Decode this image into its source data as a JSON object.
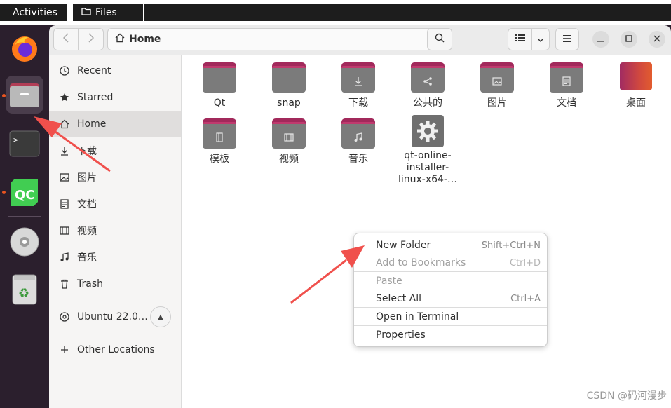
{
  "topbar": {
    "activities": "Activities",
    "app_name": "Files"
  },
  "dock": {
    "items": [
      "firefox-icon",
      "files-icon",
      "terminal-icon",
      "qt-creator-icon",
      "dvd-icon",
      "trash-icon"
    ]
  },
  "headerbar": {
    "location": "Home"
  },
  "sidebar": {
    "items": [
      {
        "label": "Recent",
        "icon": "clock-icon"
      },
      {
        "label": "Starred",
        "icon": "star-icon"
      },
      {
        "label": "Home",
        "icon": "home-icon"
      },
      {
        "label": "下载",
        "icon": "download-icon"
      },
      {
        "label": "图片",
        "icon": "image-icon"
      },
      {
        "label": "文档",
        "icon": "document-icon"
      },
      {
        "label": "视频",
        "icon": "video-icon"
      },
      {
        "label": "音乐",
        "icon": "music-icon"
      },
      {
        "label": "Trash",
        "icon": "trash-icon"
      }
    ],
    "drive": "Ubuntu 22.0…",
    "other": "Other Locations"
  },
  "files": [
    {
      "name": "Qt",
      "glyph": ""
    },
    {
      "name": "snap",
      "glyph": ""
    },
    {
      "name": "下载",
      "glyph": "download"
    },
    {
      "name": "公共的",
      "glyph": "share"
    },
    {
      "name": "图片",
      "glyph": "image"
    },
    {
      "name": "文档",
      "glyph": "document"
    },
    {
      "name": "桌面",
      "glyph": "desktop"
    },
    {
      "name": "模板",
      "glyph": "template"
    },
    {
      "name": "视频",
      "glyph": "video"
    },
    {
      "name": "音乐",
      "glyph": "music"
    },
    {
      "name_lines": [
        "qt-online-",
        "installer-",
        "linux-x64-…"
      ],
      "glyph": "gear"
    }
  ],
  "context_menu": {
    "items": [
      {
        "label": "New Folder",
        "shortcut": "Shift+Ctrl+N",
        "enabled": true
      },
      {
        "label": "Add to Bookmarks",
        "shortcut": "Ctrl+D",
        "enabled": false
      },
      {
        "label": "Paste",
        "shortcut": "",
        "enabled": false
      },
      {
        "label": "Select All",
        "shortcut": "Ctrl+A",
        "enabled": true
      },
      {
        "label": "Open in Terminal",
        "shortcut": "",
        "enabled": true
      },
      {
        "label": "Properties",
        "shortcut": "",
        "enabled": true
      }
    ]
  },
  "colors": {
    "accent": "#e95420",
    "folder_tab": "#a2295b",
    "arrow": "#f0504c"
  },
  "watermark": "CSDN @码河漫步"
}
